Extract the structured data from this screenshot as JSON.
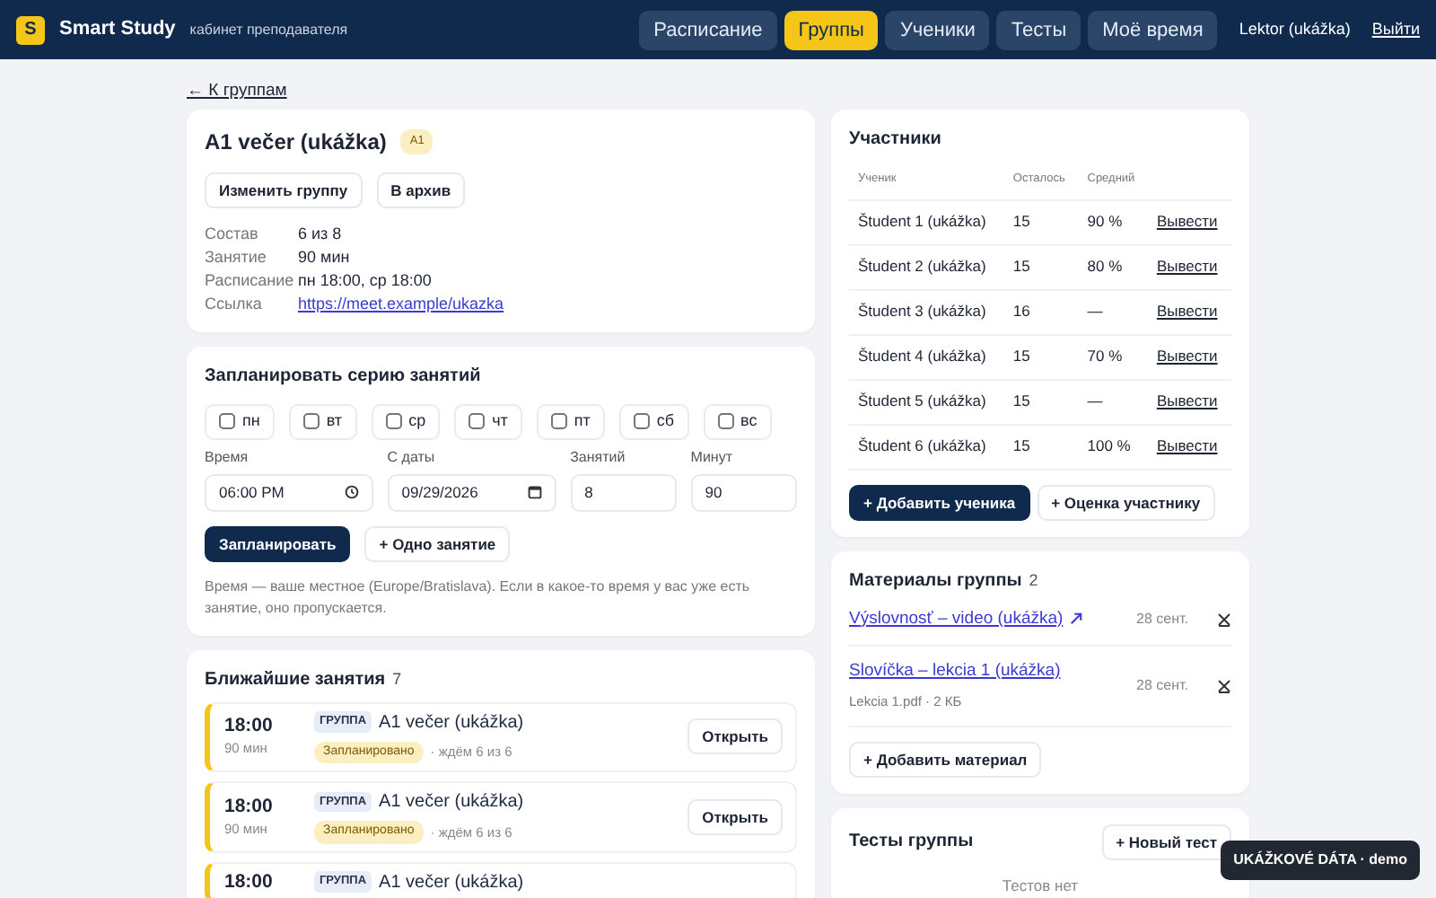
{
  "header": {
    "logo": "S",
    "brand": "Smart Study",
    "subtitle": "кабинет преподавателя",
    "user": "Lektor (ukážka)",
    "logout": "Выйти",
    "nav": [
      {
        "label": "Расписание",
        "selected": false
      },
      {
        "label": "Группы",
        "selected": true
      },
      {
        "label": "Ученики",
        "selected": false
      },
      {
        "label": "Тесты",
        "selected": false
      },
      {
        "label": "Моё время",
        "selected": false
      }
    ]
  },
  "back_link": "← К группам",
  "group": {
    "title": "A1 večer (ukážka)",
    "level_badge": "A1",
    "buttons": [
      "Изменить группу",
      "В архив"
    ],
    "details": [
      {
        "label": "Состав",
        "value": "6 из 8",
        "kind": "text"
      },
      {
        "label": "Занятие",
        "value": "90 мин",
        "kind": "text"
      },
      {
        "label": "Расписание",
        "value": "пн 18:00, ср 18:00",
        "kind": "text"
      },
      {
        "label": "Ссылка",
        "value": "https://meet.example/ukazka",
        "kind": "link"
      }
    ]
  },
  "schedule": {
    "title": "Запланировать серию занятий",
    "days": [
      {
        "label": "пн",
        "checked": false
      },
      {
        "label": "вт",
        "checked": false
      },
      {
        "label": "ср",
        "checked": false
      },
      {
        "label": "чт",
        "checked": false
      },
      {
        "label": "пт",
        "checked": false
      },
      {
        "label": "сб",
        "checked": false
      },
      {
        "label": "вс",
        "checked": false
      }
    ],
    "fields": [
      {
        "label": "Время",
        "value": "06:00 PM",
        "kind": "time"
      },
      {
        "label": "С даты",
        "value": "09/29/2026",
        "kind": "date"
      },
      {
        "label": "Занятий",
        "value": "8",
        "kind": "number"
      },
      {
        "label": "Минут",
        "value": "90",
        "kind": "number"
      }
    ],
    "primary_button": "Запланировать",
    "secondary_button": "+ Одно занятие",
    "note": "Время — ваше местное (Europe/Bratislava). Если в какое-то время у вас уже есть занятие, оно пропускается."
  },
  "upcoming": {
    "title": "Ближайшие занятия",
    "count": "7",
    "sessions": [
      {
        "time": "18:00",
        "duration": "90 мин",
        "tag": "ГРУППА",
        "name": "A1 večer (ukážka)",
        "status": "Запланировано",
        "waiting": "· ждём 6 из 6",
        "button": "Открыть"
      },
      {
        "time": "18:00",
        "duration": "90 мин",
        "tag": "ГРУППА",
        "name": "A1 večer (ukážka)",
        "status": "Запланировано",
        "waiting": "· ждём 6 из 6",
        "button": "Открыть"
      },
      {
        "time": "18:00",
        "tag": "ГРУППА",
        "name": "A1 večer (ukážka)"
      }
    ]
  },
  "participants": {
    "title": "Участники",
    "columns": [
      "Ученик",
      "Осталось",
      "Средний"
    ],
    "rows": [
      {
        "name": "Študent 1 (ukážka)",
        "remaining": "15",
        "average": "90 %",
        "action": "Вывести"
      },
      {
        "name": "Študent 2 (ukážka)",
        "remaining": "15",
        "average": "80 %",
        "action": "Вывести"
      },
      {
        "name": "Študent 3 (ukážka)",
        "remaining": "16",
        "average": "—",
        "action": "Вывести"
      },
      {
        "name": "Študent 4 (ukážka)",
        "remaining": "15",
        "average": "70 %",
        "action": "Вывести"
      },
      {
        "name": "Študent 5 (ukážka)",
        "remaining": "15",
        "average": "—",
        "action": "Вывести"
      },
      {
        "name": "Študent 6 (ukážka)",
        "remaining": "15",
        "average": "100 %",
        "action": "Вывести"
      }
    ],
    "primary_button": "+ Добавить ученика",
    "secondary_button": "+ Оценка участнику"
  },
  "materials": {
    "title": "Материалы группы",
    "count": "2",
    "items": [
      {
        "title": "Výslovnosť – video (ukážka)",
        "external": true,
        "date": "28 сент."
      },
      {
        "title": "Slovíčka – lekcia 1 (ukážka)",
        "external": false,
        "meta": "Lekcia 1.pdf · 2 КБ",
        "date": "28 сент."
      }
    ],
    "add_button": "+ Добавить материал"
  },
  "tests": {
    "title": "Тесты группы",
    "new_button": "+ Новый тест",
    "empty": "Тестов нет"
  },
  "demo_badge": "UKÁŽKOVÉ DÁTA · demo"
}
